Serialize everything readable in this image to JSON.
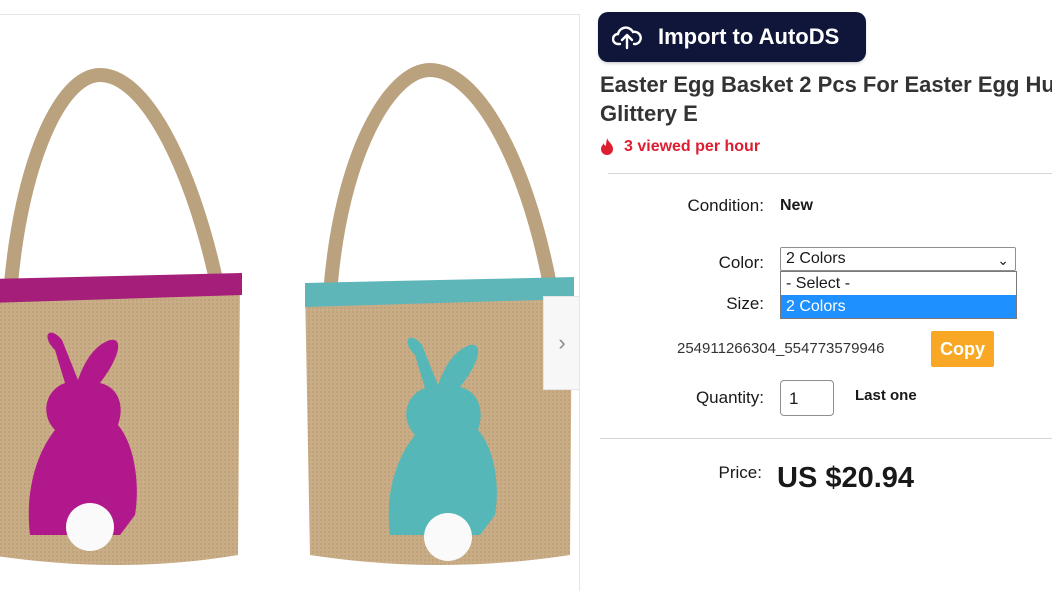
{
  "import_button": {
    "label": "Import to AutoDS",
    "icon": "cloud-upload-icon"
  },
  "product": {
    "title_line1": "Easter Egg Basket 2 Pcs For Easter Egg Hu",
    "title_line2": "Glittery E",
    "views": "3 viewed per hour"
  },
  "details": {
    "condition_label": "Condition:",
    "condition_value": "New",
    "color_label": "Color:",
    "color_selected": "2 Colors",
    "color_options": [
      "- Select -",
      "2 Colors"
    ],
    "size_label": "Size:",
    "sku": "254911266304_554773579946",
    "copy_label": "Copy",
    "quantity_label": "Quantity:",
    "quantity_value": "1",
    "stock_note": "Last one",
    "price_label": "Price:",
    "price_value": "US $20.94"
  },
  "colors": {
    "import_bg": "#10163a",
    "views_red": "#dd1e31",
    "copy_orange": "#f9a825",
    "option_highlight": "#1e90ff"
  }
}
